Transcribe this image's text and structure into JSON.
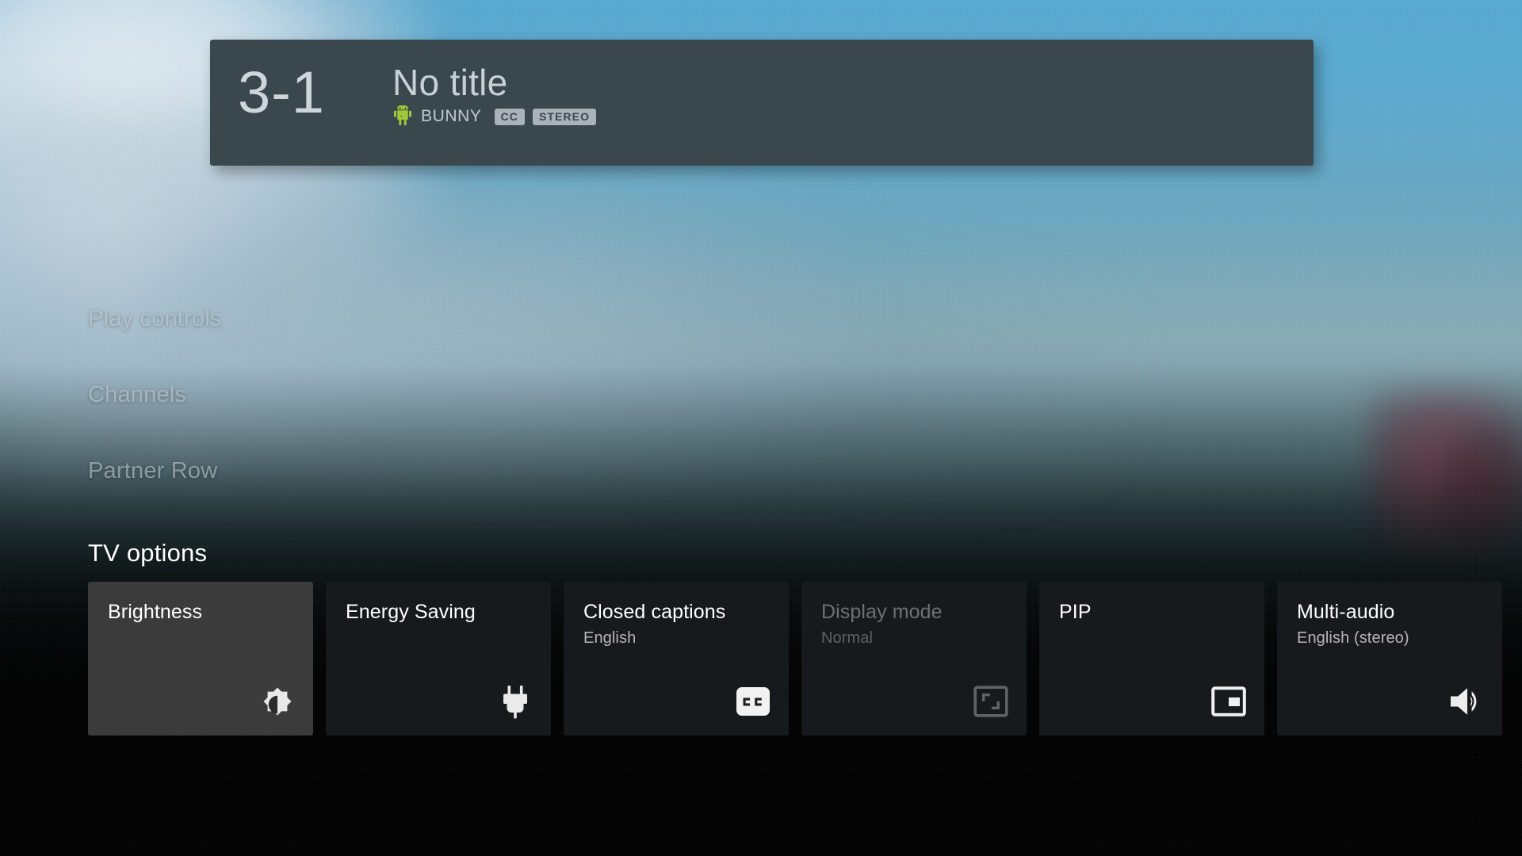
{
  "banner": {
    "channel_number": "3-1",
    "program_title": "No title",
    "source_icon": "android-robot-icon",
    "source_name": "BUNNY",
    "badges": [
      "CC",
      "STEREO"
    ],
    "background_color": "#3a484e"
  },
  "rows": [
    {
      "label": "Play controls"
    },
    {
      "label": "Channels"
    },
    {
      "label": "Partner Row"
    }
  ],
  "section": {
    "title": "TV options"
  },
  "options": [
    {
      "title": "Brightness",
      "subtitle": "",
      "icon": "brightness-icon",
      "focused": true,
      "disabled": false
    },
    {
      "title": "Energy Saving",
      "subtitle": "",
      "icon": "power-plug-icon",
      "focused": false,
      "disabled": false
    },
    {
      "title": "Closed captions",
      "subtitle": "English",
      "icon": "closed-caption-icon",
      "focused": false,
      "disabled": false
    },
    {
      "title": "Display mode",
      "subtitle": "Normal",
      "icon": "aspect-ratio-icon",
      "focused": false,
      "disabled": true
    },
    {
      "title": "PIP",
      "subtitle": "",
      "icon": "picture-in-picture-icon",
      "focused": false,
      "disabled": false
    },
    {
      "title": "Multi-audio",
      "subtitle": "English (stereo)",
      "icon": "volume-up-icon",
      "focused": false,
      "disabled": false
    }
  ],
  "colors": {
    "focus_card": "#3b3b3b",
    "card": "#161a1d",
    "banner": "#3a484e",
    "chip": "#aab3b8",
    "sky": "#57a7cf"
  }
}
